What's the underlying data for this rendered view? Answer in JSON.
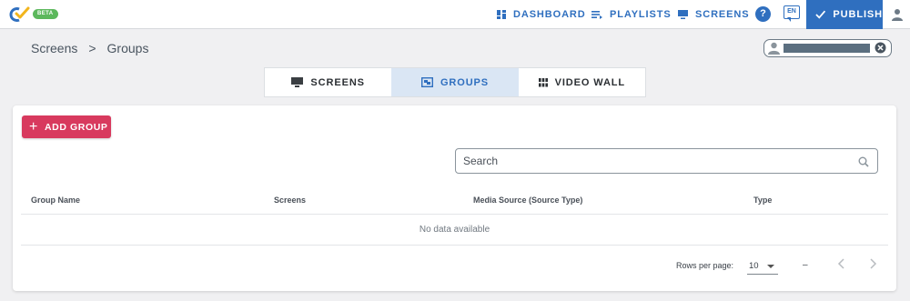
{
  "app": {
    "logo_icon": "brand-check-logo",
    "beta_label": "BETA"
  },
  "nav": {
    "dashboard": "DASHBOARD",
    "playlists": "PLAYLISTS",
    "screens": "SCREENS",
    "help": "?",
    "language": "EN",
    "publish": "PUBLISH"
  },
  "breadcrumb": {
    "root": "Screens",
    "separator": ">",
    "current": "Groups"
  },
  "tabs": [
    {
      "label": "SCREENS",
      "icon": "monitor-icon",
      "active": false
    },
    {
      "label": "GROUPS",
      "icon": "group-icon",
      "active": true
    },
    {
      "label": "VIDEO WALL",
      "icon": "grid-icon",
      "active": false
    }
  ],
  "actions": {
    "add_group": "ADD GROUP"
  },
  "search": {
    "placeholder": "Search"
  },
  "table": {
    "columns": [
      "Group Name",
      "Screens",
      "Media Source (Source Type)",
      "Type"
    ],
    "empty_text": "No data available"
  },
  "pagination": {
    "rows_per_page_label": "Rows per page:",
    "rows_per_page_value": "10",
    "range": "–"
  },
  "colors": {
    "primary": "#2f6fbf",
    "accent": "#d83a5e",
    "beta": "#5cb85c",
    "active_tab_bg": "#dae6f4"
  }
}
